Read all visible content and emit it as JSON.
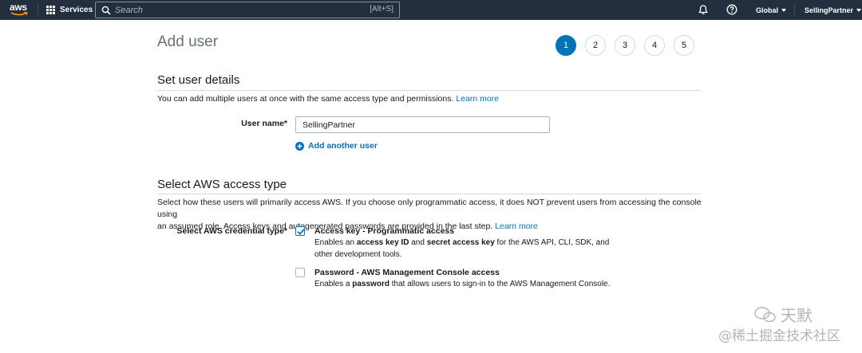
{
  "nav": {
    "logo_text": "aws",
    "services_label": "Services",
    "search_placeholder": "Search",
    "search_shortcut": "[Alt+S]",
    "region_label": "Global",
    "account_label": "SellingPartner",
    "bg_color": "#232f3e"
  },
  "page": {
    "title": "Add user",
    "steps": [
      "1",
      "2",
      "3",
      "4",
      "5"
    ],
    "active_step": 1,
    "accent_color": "#0073bb"
  },
  "details": {
    "heading": "Set user details",
    "description": "You can add multiple users at once with the same access type and permissions.",
    "learn_more": "Learn more",
    "user_name_label": "User name*",
    "user_name_value": "SellingPartner",
    "add_another_label": "Add another user"
  },
  "access": {
    "heading": "Select AWS access type",
    "description_line1": "Select how these users will primarily access AWS. If you choose only programmatic access, it does NOT prevent users from accessing the console using",
    "description_line2": "an assumed role. Access keys and autogenerated passwords are provided in the last step.",
    "learn_more": "Learn more",
    "credential_label": "Select AWS credential type*",
    "options": [
      {
        "title": "Access key - Programmatic access",
        "checked": true,
        "desc_parts": [
          "Enables an ",
          "access key ID",
          " and ",
          "secret access key",
          " for the AWS API, CLI, SDK, and"
        ],
        "desc_line2": "other development tools."
      },
      {
        "title": "Password - AWS Management Console access",
        "checked": false,
        "desc_parts": [
          "Enables a ",
          "password",
          " that allows users to sign-in to the AWS Management Console."
        ]
      }
    ]
  },
  "watermark": {
    "line1": "天默",
    "line2": "@稀土掘金技术社区"
  }
}
